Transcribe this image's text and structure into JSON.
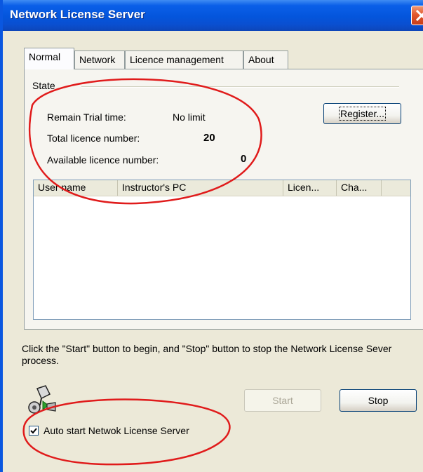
{
  "window": {
    "title": "Network License Server",
    "close_icon": "close-icon"
  },
  "tabs": [
    {
      "label": "Normal",
      "active": true
    },
    {
      "label": "Network",
      "active": false
    },
    {
      "label": "Licence management",
      "active": false
    },
    {
      "label": "About",
      "active": false
    }
  ],
  "state": {
    "group_label": "State",
    "remain_trial_label": "Remain Trial time:",
    "remain_trial_value": "No limit",
    "total_licence_label": "Total licence number:",
    "total_licence_value": "20",
    "available_licence_label": "Available licence number:",
    "available_licence_value": "0",
    "register_button": "Register..."
  },
  "table": {
    "columns": [
      "User name",
      "Instructor's PC",
      "Licen...",
      "Cha..."
    ],
    "rows": []
  },
  "instructions": "Click the \"Start\" button to begin, and \"Stop\" button to stop the Network License Sever process.",
  "buttons": {
    "start": "Start",
    "stop": "Stop"
  },
  "autostart": {
    "label": "Auto start Netwok License Server",
    "checked": true
  },
  "colors": {
    "titlebar": "#0455dc",
    "annotation": "#e01b1b",
    "close": "#e2572d"
  }
}
